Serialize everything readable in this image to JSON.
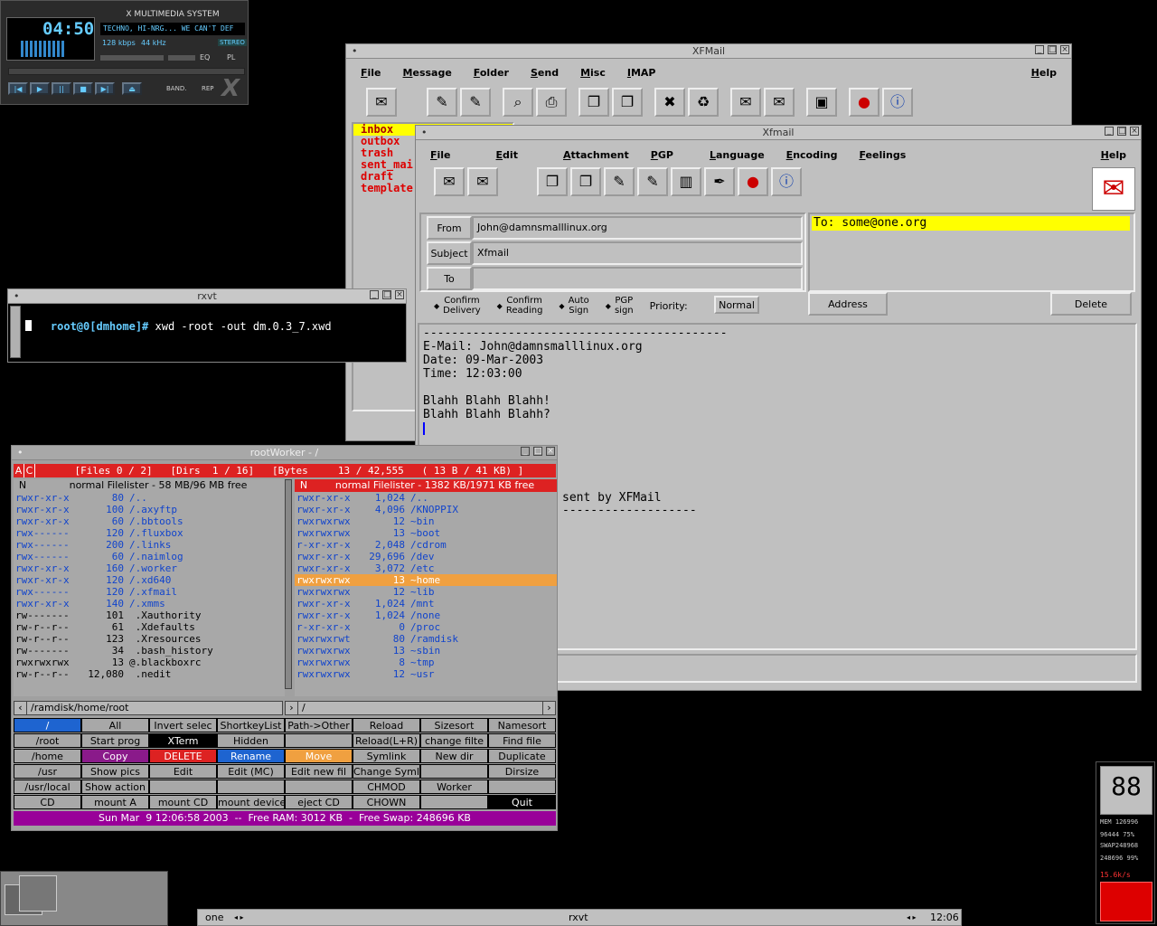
{
  "xmms": {
    "time": "04:50",
    "title": "X MULTIMEDIA SYSTEM",
    "marquee": "TECHNO, HI-NRG... WE CAN'T DEF",
    "kbps": "128 kbps",
    "khz": "44 kHz",
    "mode": "STEREO",
    "eq": "EQ",
    "pl": "PL",
    "band": "BAND.",
    "rep": "REP"
  },
  "xfmail": {
    "title": "XFMail",
    "menu": [
      "File",
      "Message",
      "Folder",
      "Send",
      "Misc",
      "IMAP"
    ],
    "help": "Help",
    "folders": [
      "inbox",
      "outbox",
      "trash",
      "sent_mai",
      "draft",
      "template"
    ]
  },
  "compose": {
    "title": "Xfmail",
    "menu": [
      "File",
      "Edit",
      "Attachment",
      "PGP",
      "Language",
      "Encoding",
      "Feelings"
    ],
    "help": "Help",
    "from_label": "From",
    "from_value": "John@damnsmalllinux.org",
    "subject_label": "Subject",
    "subject_value": "Xfmail",
    "to_label": "To",
    "to_value": "",
    "to_header": "To: some@one.org",
    "opts": [
      "Confirm\nDelivery",
      "Confirm\nReading",
      "Auto\nSign",
      "PGP\nsign"
    ],
    "priority_label": "Priority:",
    "priority_value": "Normal",
    "address": "Address",
    "delete": "Delete",
    "body": [
      "-------------------------------------------",
      "E-Mail: John@damnsmalllinux.org",
      "Date: 09-Mar-2003",
      "Time: 12:03:00",
      "",
      "Blahh Blahh Blahh!",
      "Blahh Blahh Blahh?"
    ],
    "sig1": "sent by XFMail",
    "sig2": "-------------------"
  },
  "rxvt": {
    "title": "rxvt",
    "prompt": "root@0[dmhome]#",
    "command": " xwd -root -out dm.0.3_7.xwd"
  },
  "worker": {
    "title": "rootWorker - /",
    "status": "[Files 0 / 2]   [Dirs  1 / 16]   [Bytes     13 / 42,555   ( 13 B / 41 KB) ]",
    "left_header": "normal Filelister - 58 MB/96 MB free",
    "right_header": "normal Filelister - 1382 KB/1971 KB free",
    "left_path": "/ramdisk/home/root",
    "right_path": "/",
    "left": [
      [
        "rwxr-xr-x",
        "80",
        "/.."
      ],
      [
        "rwxr-xr-x",
        "100",
        "/.axyftp"
      ],
      [
        "rwxr-xr-x",
        "60",
        "/.bbtools"
      ],
      [
        "rwx------",
        "120",
        "/.fluxbox"
      ],
      [
        "rwx------",
        "200",
        "/.links"
      ],
      [
        "rwx------",
        "60",
        "/.naimlog"
      ],
      [
        "rwxr-xr-x",
        "160",
        "/.worker"
      ],
      [
        "rwxr-xr-x",
        "120",
        "/.xd640"
      ],
      [
        "rwx------",
        "120",
        "/.xfmail"
      ],
      [
        "rwxr-xr-x",
        "140",
        "/.xmms"
      ],
      [
        "rw-------",
        "101",
        " .Xauthority"
      ],
      [
        "rw-r--r--",
        "61",
        " .Xdefaults"
      ],
      [
        "rw-r--r--",
        "123",
        " .Xresources"
      ],
      [
        "rw-------",
        "34",
        " .bash_history"
      ],
      [
        "rwxrwxrwx",
        "13",
        "@.blackboxrc"
      ],
      [
        "rw-r--r--",
        "12,080",
        " .nedit"
      ]
    ],
    "right": [
      [
        "rwxr-xr-x",
        "1,024",
        "/.."
      ],
      [
        "rwxr-xr-x",
        "4,096",
        "/KNOPPIX"
      ],
      [
        "rwxrwxrwx",
        "12",
        "~bin"
      ],
      [
        "rwxrwxrwx",
        "13",
        "~boot"
      ],
      [
        "r-xr-xr-x",
        "2,048",
        "/cdrom"
      ],
      [
        "rwxr-xr-x",
        "29,696",
        "/dev"
      ],
      [
        "rwxr-xr-x",
        "3,072",
        "/etc"
      ],
      [
        "rwxrwxrwx",
        "13",
        "~home"
      ],
      [
        "rwxrwxrwx",
        "12",
        "~lib"
      ],
      [
        "rwxr-xr-x",
        "1,024",
        "/mnt"
      ],
      [
        "rwxr-xr-x",
        "1,024",
        "/none"
      ],
      [
        "r-xr-xr-x",
        "0",
        "/proc"
      ],
      [
        "rwxrwxrwt",
        "80",
        "/ramdisk"
      ],
      [
        "rwxrwxrwx",
        "13",
        "~sbin"
      ],
      [
        "rwxrwxrwx",
        "8",
        "~tmp"
      ],
      [
        "rwxrwxrwx",
        "12",
        "~usr"
      ]
    ],
    "buttons": [
      [
        "/",
        "All",
        "Invert selec",
        "ShortkeyList",
        "Path->Other",
        "Reload",
        "Sizesort",
        "Namesort"
      ],
      [
        "/root",
        "Start prog",
        "XTerm",
        "Hidden",
        "",
        "Reload(L+R)",
        "change filte",
        "Find file"
      ],
      [
        "/home",
        "Copy",
        "DELETE",
        "Rename",
        "Move",
        "Symlink",
        "New dir",
        "Duplicate"
      ],
      [
        "/usr",
        "Show pics",
        "Edit",
        "Edit (MC)",
        "Edit new fil",
        "Change Symli",
        "",
        "Dirsize"
      ],
      [
        "/usr/local",
        "Show action",
        "",
        "",
        "",
        "CHMOD",
        "Worker",
        ""
      ],
      [
        "CD",
        "mount A",
        "mount CD",
        "mount device",
        "eject CD",
        "CHOWN",
        "",
        "Quit"
      ]
    ],
    "footer": "Sun Mar  9 12:06:58 2003  --  Free RAM: 3012 KB  -  Free Swap: 248696 KB"
  },
  "monitor": {
    "mem_label": "MEM",
    "mem": "126996",
    "mem2": "96444",
    "pct1": "75%",
    "swap_label": "SWAP",
    "swap": "248968",
    "swap2": "248696",
    "pct2": "99%",
    "net": "15.6k/s"
  },
  "taskbar": {
    "workspace": "one",
    "task": "rxvt",
    "clock": "12:06"
  }
}
